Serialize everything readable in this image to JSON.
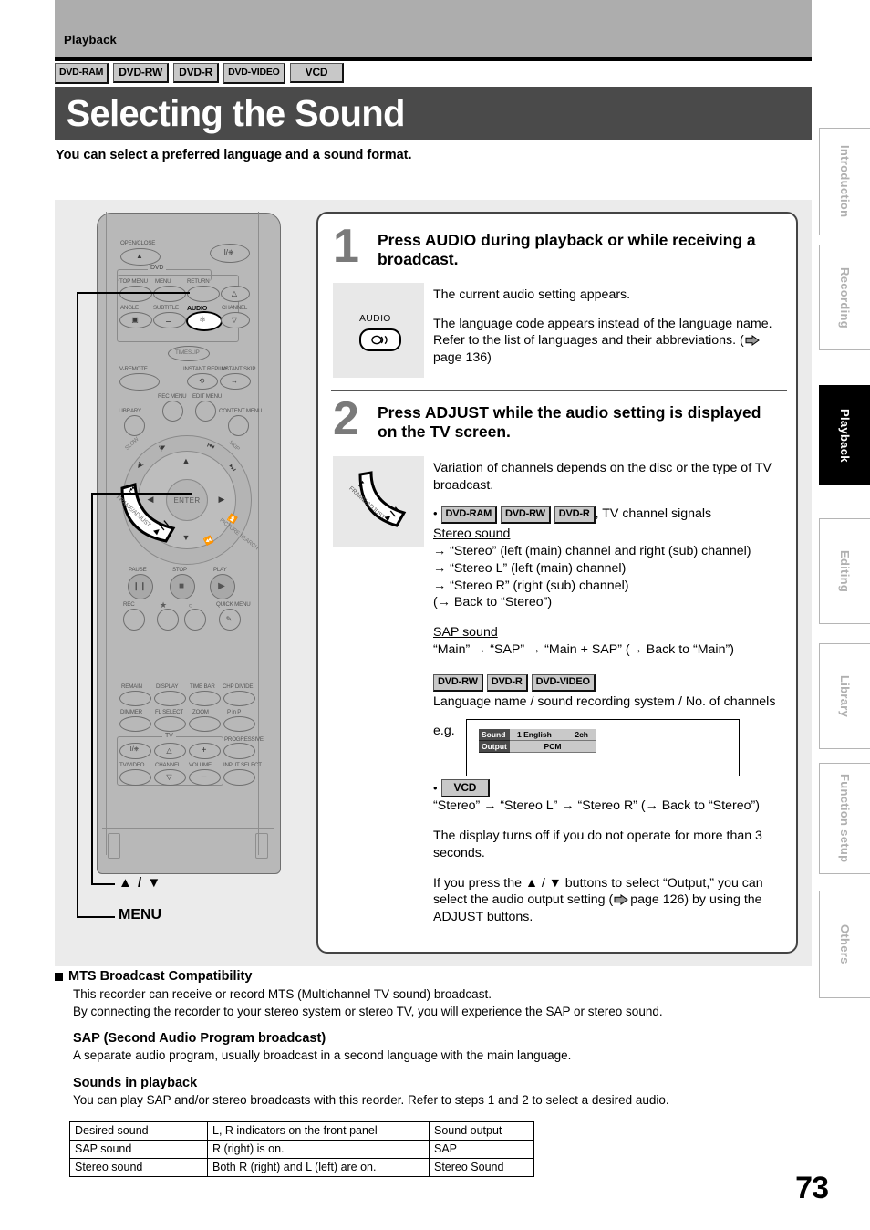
{
  "header": {
    "chapter": "Playback",
    "title": "Selecting the Sound",
    "lead": "You can select a preferred language and a sound format.",
    "disc_badges": [
      {
        "label": "DVD-RAM",
        "style": "narrow"
      },
      {
        "label": "DVD-RW",
        "style": "normal"
      },
      {
        "label": "DVD-R",
        "style": "normal"
      },
      {
        "label": "DVD-VIDEO",
        "style": "narrow"
      },
      {
        "label": "VCD",
        "style": "vcd"
      }
    ]
  },
  "tabs": [
    {
      "label": "Introduction",
      "active": false
    },
    {
      "label": "Recording",
      "active": false
    },
    {
      "label": "Playback",
      "active": true
    },
    {
      "label": "Editing",
      "active": false
    },
    {
      "label": "Library",
      "active": false
    },
    {
      "label": "Function setup",
      "active": false
    },
    {
      "label": "Others",
      "active": false
    }
  ],
  "remote": {
    "callout_up_down": "▲ / ▼",
    "callout_menu": "MENU",
    "labels": {
      "open_close": "OPEN/CLOSE",
      "dvd": "DVD",
      "top_menu": "TOP MENU",
      "menu": "MENU",
      "return": "RETURN",
      "angle": "ANGLE",
      "subtitle": "SUBTITLE",
      "audio": "AUDIO",
      "channel": "CHANNEL",
      "timeslip": "TIMESLIP",
      "v_remote": "V-REMOTE",
      "instant_replay": "INSTANT REPLAY",
      "instant_skip": "INSTANT SKIP",
      "rec_menu": "REC MENU",
      "edit_menu": "EDIT MENU",
      "library": "LIBRARY",
      "content_menu": "CONTENT MENU",
      "slow": "SLOW",
      "skip": "SKIP",
      "enter": "ENTER",
      "frame_adjust": "FRAME/ADJUST",
      "picture_search": "PICTURE SEARCH",
      "pause": "PAUSE",
      "stop": "STOP",
      "play": "PLAY",
      "rec": "REC",
      "quick_menu": "QUICK MENU",
      "remain": "REMAIN",
      "display": "DISPLAY",
      "time_bar": "TIME BAR",
      "chp_divide": "CHP DIVIDE",
      "dimmer": "DIMMER",
      "fl_select": "FL SELECT",
      "zoom": "ZOOM",
      "p_in_p": "P in P",
      "tv": "TV",
      "progressive": "PROGRESSIVE",
      "tv_video": "TV/VIDEO",
      "tv_channel": "CHANNEL",
      "volume": "VOLUME",
      "input_select": "INPUT SELECT"
    }
  },
  "steps": [
    {
      "number": "1",
      "heading": "Press AUDIO during playback or while receiving a broadcast.",
      "icon_caption": "AUDIO",
      "body_p1": "The current audio setting appears.",
      "body_p2_a": "The language code appears instead of the language name. Refer to the list of languages and their abbreviations. (",
      "body_p2_b": "page 136)"
    },
    {
      "number": "2",
      "heading": "Press ADJUST while the audio setting is displayed on the TV screen.",
      "icon_caption": "FRAME/ADJUST",
      "intro": "Variation of channels depends on the disc or the type of TV broadcast.",
      "bullet1_badges": [
        "DVD-RAM",
        "DVD-RW",
        "DVD-R"
      ],
      "bullet1_tail": ", TV channel signals",
      "stereo_title": "Stereo sound",
      "stereo_lines": [
        "→ “Stereo” (left (main) channel and right (sub) channel)",
        "→ “Stereo L” (left (main) channel)",
        "→ “Stereo R” (right (sub) channel)",
        "(→ Back to “Stereo”)"
      ],
      "sap_title": "SAP sound",
      "sap_line": "“Main” → “SAP” → “Main + SAP” (→ Back to “Main”)",
      "bullet2_badges": [
        "DVD-RW",
        "DVD-R",
        "DVD-VIDEO"
      ],
      "bullet2_text": "Language name / sound recording system / No. of channels",
      "eg_label": "e.g.",
      "osd": {
        "row1_key": "Sound",
        "row1_left": "1  English",
        "row1_right": "2ch",
        "row2_key": "Output",
        "row2_center": "PCM"
      },
      "vcd_badge": "VCD",
      "vcd_line": "“Stereo” → “Stereo L” → “Stereo R” (→ Back to “Stereo”)",
      "note1": "The display turns off if you do not operate for more than 3 seconds.",
      "note2_a": "If you press the ▲ / ▼ buttons to select “Output,” you can select the audio output setting (",
      "note2_b": "page 126) by using the ADJUST buttons."
    }
  ],
  "lower": {
    "mts_title": "MTS Broadcast Compatibility",
    "mts_line1": "This recorder can receive or record MTS (Multichannel TV sound) broadcast.",
    "mts_line2": "By connecting the recorder to your stereo system or stereo TV, you will experience the SAP or stereo sound.",
    "sap_title": "SAP (Second Audio Program broadcast)",
    "sap_line": "A separate audio program, usually broadcast in a second language with the main language.",
    "sounds_title": "Sounds in playback",
    "sounds_line": "You can play SAP and/or stereo broadcasts with this reorder. Refer to steps 1 and 2 to select a desired audio."
  },
  "table": {
    "headers": [
      "Desired sound",
      "L, R indicators on the front panel",
      "Sound output"
    ],
    "rows": [
      [
        "SAP sound",
        "R (right) is on.",
        "SAP"
      ],
      [
        "Stereo sound",
        "Both R (right) and L (left) are on.",
        "Stereo Sound"
      ]
    ]
  },
  "page_number": "73"
}
